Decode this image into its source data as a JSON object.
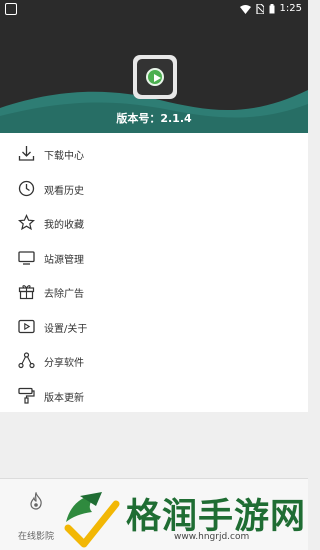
{
  "status_bar": {
    "time": "1:25"
  },
  "header": {
    "version_text": "版本号：2.1.4"
  },
  "menu": {
    "items": [
      {
        "label": "下载中心",
        "icon": "download-icon"
      },
      {
        "label": "观看历史",
        "icon": "clock-icon"
      },
      {
        "label": "我的收藏",
        "icon": "star-icon"
      },
      {
        "label": "站源管理",
        "icon": "monitor-icon"
      },
      {
        "label": "去除广告",
        "icon": "gift-icon"
      },
      {
        "label": "设置/关于",
        "icon": "play-settings-icon"
      },
      {
        "label": "分享软件",
        "icon": "share-icon"
      },
      {
        "label": "版本更新",
        "icon": "paint-roller-icon"
      }
    ]
  },
  "tabbar": {
    "tabs": [
      {
        "label": "在线影院",
        "icon": "flame-icon"
      }
    ]
  },
  "watermark": {
    "text": "格润手游网",
    "url": "www.hngrjd.com"
  },
  "colors": {
    "header_bg": "#2b2b2b",
    "teal": "#2e7d74",
    "accent_green": "#4caf50"
  }
}
